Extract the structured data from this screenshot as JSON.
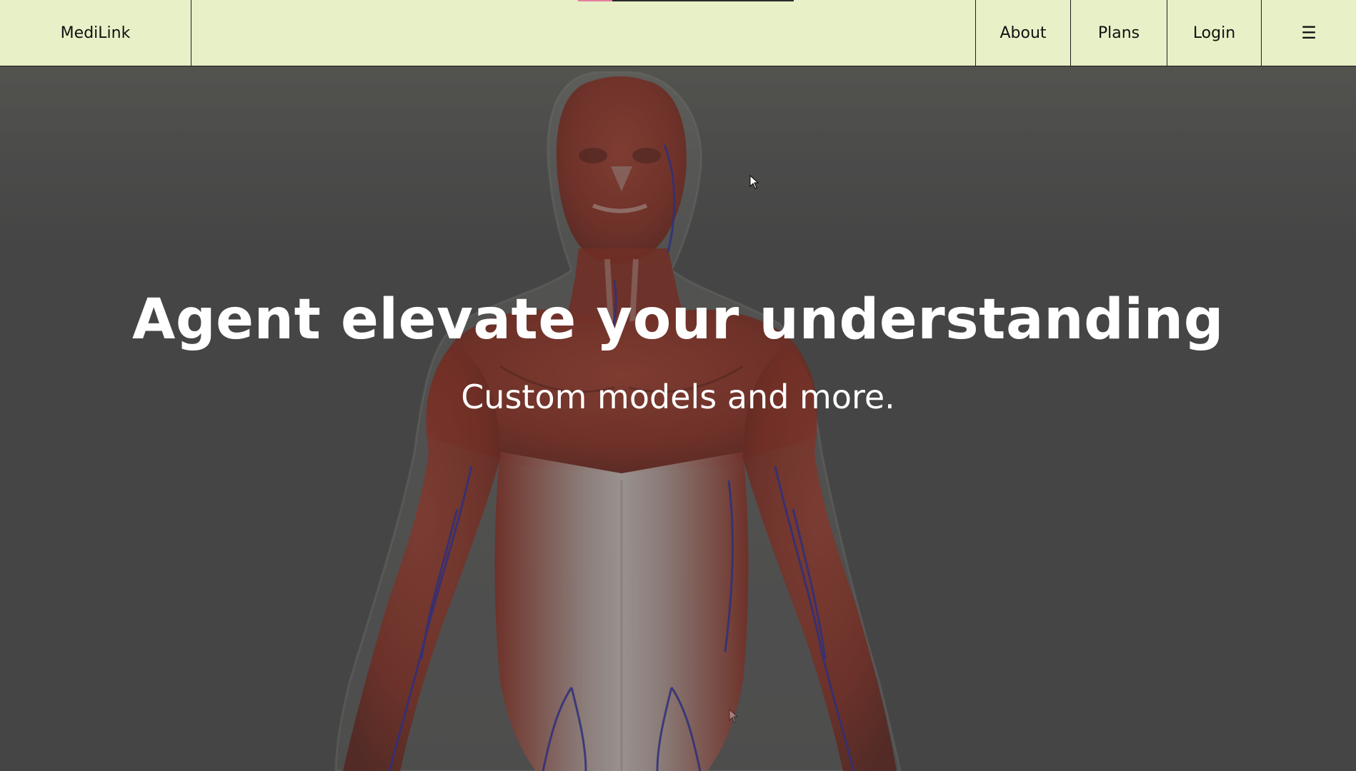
{
  "navbar": {
    "brand": "MediLink",
    "links": [
      {
        "label": "About"
      },
      {
        "label": "Plans"
      },
      {
        "label": "Login"
      }
    ],
    "menu_icon": "☰",
    "menu_icon_name": "hamburger-menu-icon",
    "scroll_progress": 0.16
  },
  "hero": {
    "title": "Agent elevate your understanding",
    "subtitle": "Custom models and more.",
    "background_image": "human-anatomy-muscles-and-veins-figure"
  },
  "colors": {
    "navbar_bg": "#e8f0c7",
    "hero_bg": "#4a4a4a",
    "muscle": "#8a2a1c",
    "veins": "#2a2a8a",
    "progress_accent": "#e77fa0",
    "text_light": "#ffffff"
  }
}
